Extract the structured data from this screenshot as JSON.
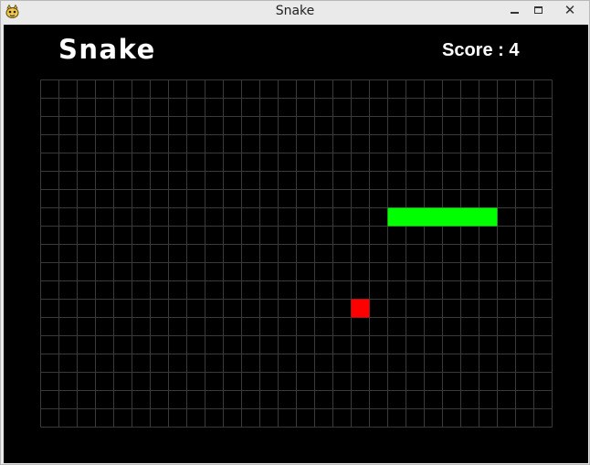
{
  "window": {
    "title": "Snake"
  },
  "game": {
    "title": "Snake",
    "score_label": "Score :",
    "score": 4,
    "grid": {
      "cols": 28,
      "rows": 19
    },
    "snake": {
      "cells": [
        [
          19,
          7
        ],
        [
          20,
          7
        ],
        [
          21,
          7
        ],
        [
          22,
          7
        ],
        [
          23,
          7
        ],
        [
          24,
          7
        ]
      ]
    },
    "food": {
      "cell": [
        17,
        12
      ]
    },
    "colors": {
      "background": "#000000",
      "grid_line": "#3a3a3a",
      "snake": "#00ff00",
      "food": "#ff0000",
      "text": "#ffffff"
    }
  },
  "icons": {
    "app": "pygame-snake-icon"
  }
}
